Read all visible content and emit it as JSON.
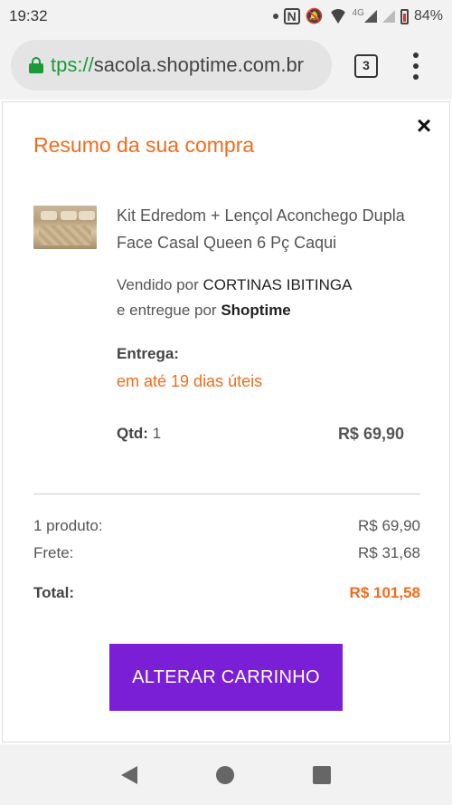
{
  "status_bar": {
    "time": "19:32",
    "network_tag": "4G",
    "battery": "84%"
  },
  "browser": {
    "url_scheme": "tps://",
    "url_host": "sacola.shoptime.com.br",
    "tab_count": "3"
  },
  "modal": {
    "title": "Resumo da sua compra",
    "close": "×",
    "product": {
      "name": "Kit Edredom + Lençol Aconchego Dupla Face Casal Queen 6 Pç Caqui",
      "seller_prefix": "Vendido por ",
      "seller": "CORTINAS IBITINGA",
      "delivered_prefix": "e entregue por ",
      "delivered_by": "Shoptime",
      "delivery_label": "Entrega:",
      "delivery_value": "em até 19 dias úteis",
      "qty_label": "Qtd:",
      "qty_value": "1",
      "price": "R$ 69,90"
    },
    "summary": {
      "products_label": "1 produto:",
      "products_value": "R$ 69,90",
      "shipping_label": "Frete:",
      "shipping_value": "R$ 31,68",
      "total_label": "Total:",
      "total_value": "R$ 101,58"
    },
    "button_label": "ALTERAR CARRINHO"
  },
  "colors": {
    "accent": "#f26b1d",
    "button": "#7b1fd6",
    "secure": "#1a9a3a"
  }
}
